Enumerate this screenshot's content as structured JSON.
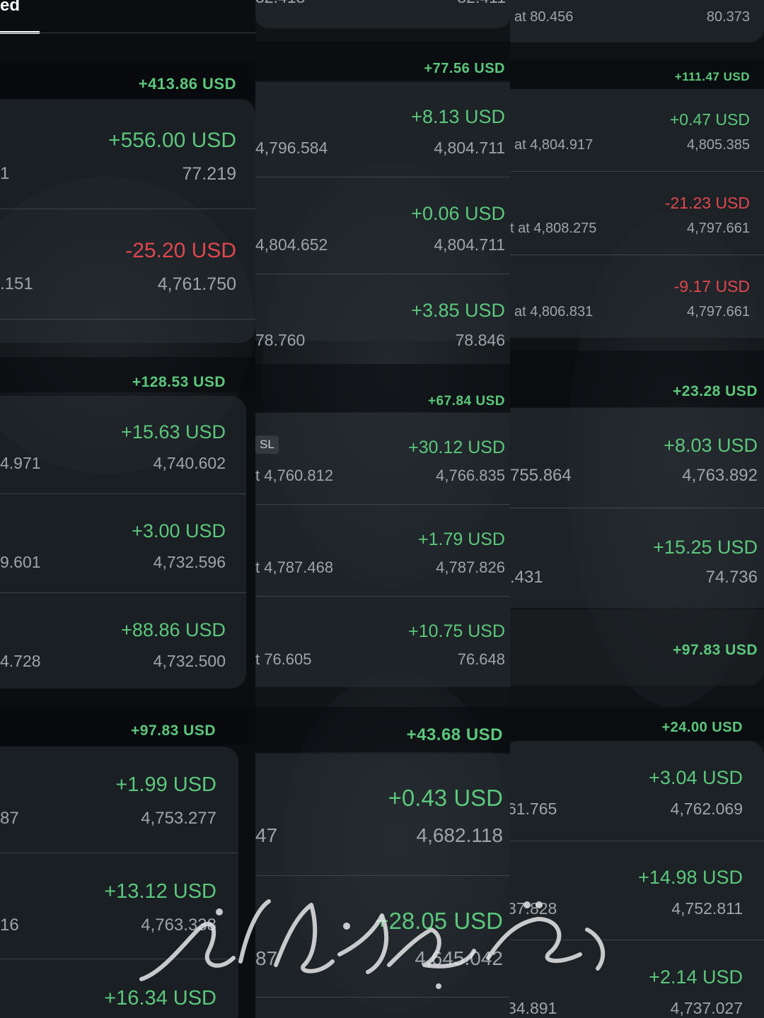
{
  "colA": {
    "tab_label": "ed",
    "groups": [
      {
        "total": "+413.86 USD",
        "trades": [
          {
            "pnl": "+556.00 USD",
            "open": "1",
            "price": "77.219"
          },
          {
            "pnl": "-25.20 USD",
            "open": ".151",
            "price": "4,761.750"
          }
        ]
      },
      {
        "total": "+128.53 USD",
        "trades": [
          {
            "pnl": "+15.63 USD",
            "open": "4.971",
            "price": "4,740.602"
          },
          {
            "pnl": "+3.00 USD",
            "open": "9.601",
            "price": "4,732.596"
          },
          {
            "pnl": "+88.86 USD",
            "open": "4.728",
            "price": "4,732.500"
          }
        ]
      },
      {
        "total": "+97.83 USD",
        "trades": [
          {
            "pnl": "+1.99 USD",
            "open": "87",
            "price": "4,753.277"
          },
          {
            "pnl": "+13.12 USD",
            "open": "16",
            "price": "4,763.338"
          },
          {
            "pnl": "+16.34 USD"
          }
        ]
      }
    ]
  },
  "colB": {
    "top_partial": {
      "left": "32.418",
      "right": "82.411"
    },
    "groups": [
      {
        "total": "+77.56 USD",
        "trades": [
          {
            "pnl": "+8.13 USD",
            "open": "4,796.584",
            "price": "4,804.711"
          },
          {
            "pnl": "+0.06 USD",
            "open": "4,804.652",
            "price": "4,804.711"
          },
          {
            "pnl": "+3.85 USD",
            "open": "78.760",
            "price": "78.846"
          }
        ]
      },
      {
        "total": "+67.84 USD",
        "trades": [
          {
            "pnl": "+30.12 USD",
            "badge": "SL",
            "open": "t 4,760.812",
            "price": "4,766.835"
          },
          {
            "pnl": "+1.79 USD",
            "open": "t 4,787.468",
            "price": "4,787.826"
          },
          {
            "pnl": "+10.75 USD",
            "open": "t 76.605",
            "price": "76.648"
          }
        ]
      },
      {
        "total": "+43.68 USD",
        "trades": [
          {
            "pnl": "+0.43 USD",
            "open": "47",
            "price": "4,682.118"
          },
          {
            "pnl": "+28.05 USD",
            "open": "87",
            "price": "4,645.042"
          }
        ]
      }
    ]
  },
  "colC": {
    "top_row": {
      "open": "at 80.456",
      "price": "80.373"
    },
    "groups": [
      {
        "total": "+111.47 USD",
        "trades": [
          {
            "pnl": "+0.47 USD",
            "open": "at 4,804.917",
            "price": "4,805.385"
          },
          {
            "pnl": "-21.23 USD",
            "open": "t at 4,808.275",
            "price": "4,797.661"
          },
          {
            "pnl": "-9.17 USD",
            "open": "at 4,806.831",
            "price": "4,797.661"
          }
        ]
      },
      {
        "total": "+23.28 USD",
        "trades": [
          {
            "pnl": "+8.03 USD",
            "open": "755.864",
            "price": "4,763.892"
          },
          {
            "pnl": "+15.25 USD",
            "open": ".431",
            "price": "74.736"
          }
        ]
      },
      {
        "total": "+97.83 USD",
        "trades": []
      },
      {
        "total": "+24.00 USD",
        "trades": [
          {
            "pnl": "+3.04 USD",
            "open": "61.765",
            "price": "4,762.069"
          },
          {
            "pnl": "+14.98 USD",
            "open": "37.828",
            "price": "4,752.811"
          },
          {
            "pnl": "+2.14 USD",
            "open": "34.891",
            "price": "4,737.027"
          }
        ]
      }
    ]
  },
  "colors": {
    "profit": "#5cc77c",
    "loss": "#e0474e",
    "tab_underline": "#ffffff"
  }
}
